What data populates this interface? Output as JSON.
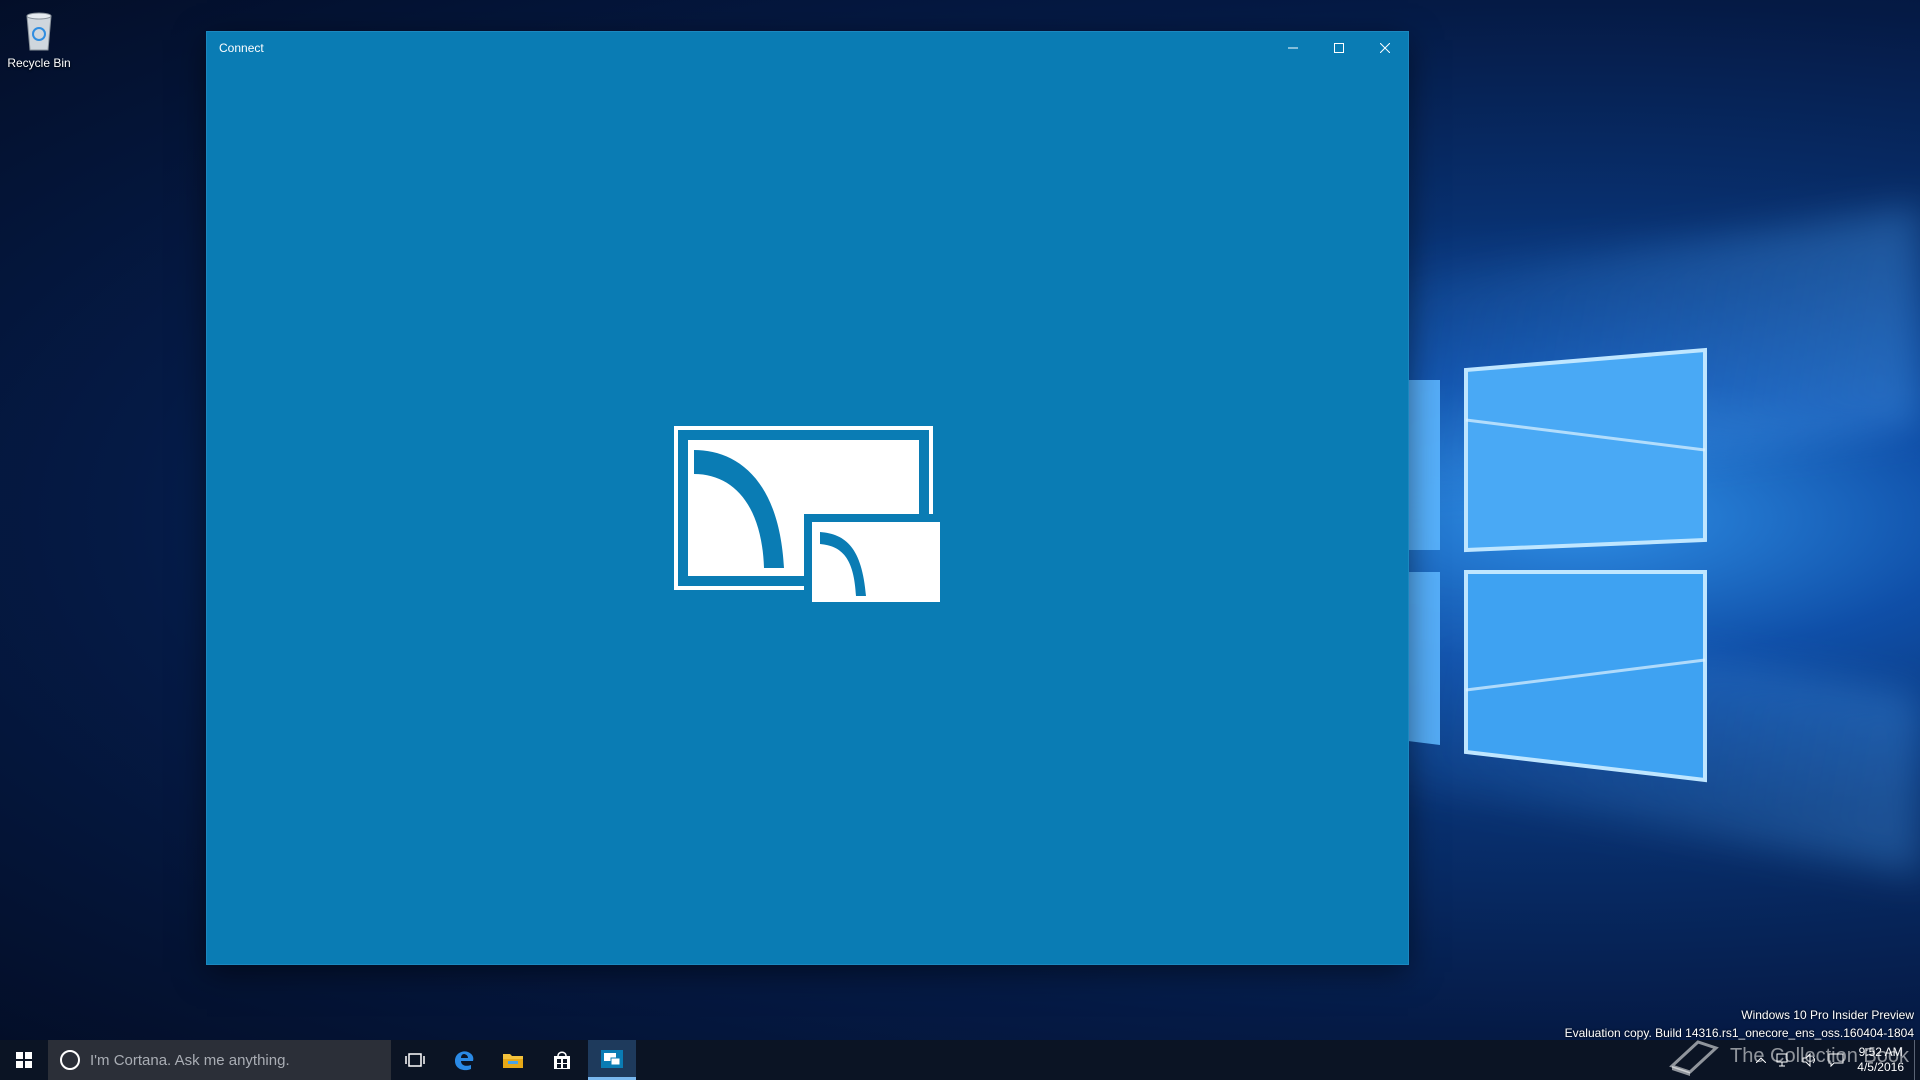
{
  "desktop": {
    "icons": [
      {
        "label": "Recycle Bin",
        "icon": "recycle-bin-icon"
      }
    ],
    "watermark": {
      "line1": "Windows 10 Pro Insider Preview",
      "line2": "Evaluation copy. Build 14316.rs1_onecore_ens_oss.160404-1804"
    },
    "brand_overlay": "The Collection Book"
  },
  "window": {
    "title": "Connect",
    "buttons": {
      "minimize": "minimize-icon",
      "maximize": "maximize-icon",
      "close": "close-icon"
    },
    "background": "#0a7cb4",
    "content_icon": "connect-app-icon"
  },
  "taskbar": {
    "search_placeholder": "I'm Cortana. Ask me anything.",
    "pinned": [
      "task-view-icon",
      "edge-icon",
      "file-explorer-icon",
      "store-icon",
      "connect-icon"
    ],
    "active_app": "connect-icon",
    "tray": {
      "icons": [
        "chevron-up-icon",
        "network-icon",
        "volume-icon",
        "action-center-icon"
      ],
      "time": "9:52 AM",
      "date": "4/5/2016"
    }
  }
}
